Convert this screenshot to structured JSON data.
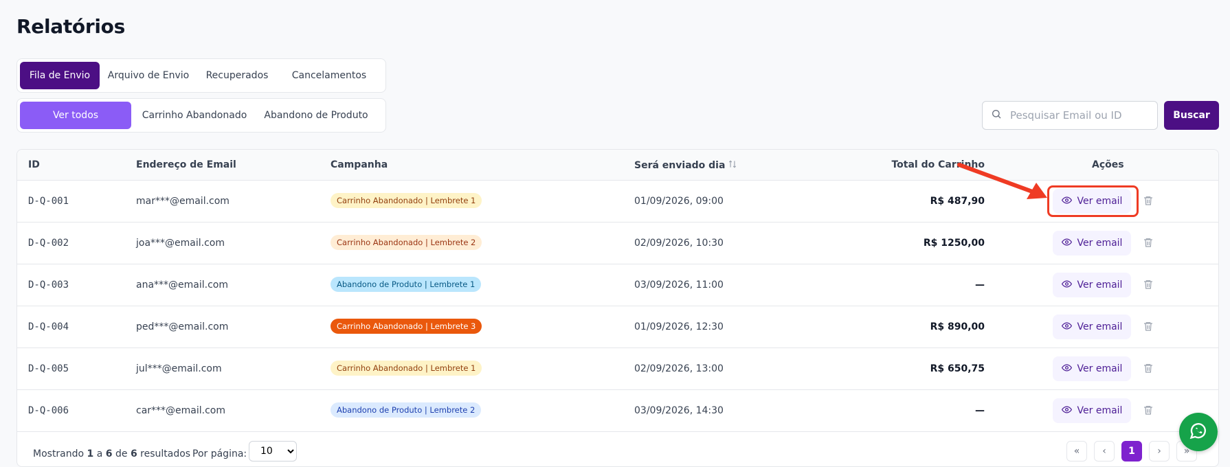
{
  "page": {
    "title": "Relatórios"
  },
  "tabs": [
    {
      "label": "Fila de Envio",
      "active": true
    },
    {
      "label": "Arquivo de Envio"
    },
    {
      "label": "Recuperados"
    },
    {
      "label": "Cancelamentos"
    }
  ],
  "subtabs": [
    {
      "label": "Ver todos",
      "active": true
    },
    {
      "label": "Carrinho Abandonado"
    },
    {
      "label": "Abandono de Produto"
    }
  ],
  "search": {
    "placeholder": "Pesquisar Email ou ID",
    "button_label": "Buscar"
  },
  "table": {
    "headers": {
      "id": "ID",
      "email": "Endereço de Email",
      "campaign": "Campanha",
      "date": "Será enviado dia",
      "total": "Total do Carrinho",
      "actions": "Ações"
    },
    "rows": [
      {
        "id": "D-Q-001",
        "email": "mar***@email.com",
        "campaign": "Carrinho Abandonado | Lembrete 1",
        "date": "01/09/2026, 09:00",
        "total": "R$ 487,90",
        "action": "Ver email"
      },
      {
        "id": "D-Q-002",
        "email": "joa***@email.com",
        "campaign": "Carrinho Abandonado | Lembrete 2",
        "date": "02/09/2026, 10:30",
        "total": "R$ 1250,00",
        "action": "Ver email"
      },
      {
        "id": "D-Q-003",
        "email": "ana***@email.com",
        "campaign": "Abandono de Produto | Lembrete 1",
        "date": "03/09/2026, 11:00",
        "total": "—",
        "action": "Ver email"
      },
      {
        "id": "D-Q-004",
        "email": "ped***@email.com",
        "campaign": "Carrinho Abandonado | Lembrete 3",
        "date": "01/09/2026, 12:30",
        "total": "R$ 890,00",
        "action": "Ver email"
      },
      {
        "id": "D-Q-005",
        "email": "jul***@email.com",
        "campaign": "Carrinho Abandonado | Lembrete 1",
        "date": "02/09/2026, 13:00",
        "total": "R$ 650,75",
        "action": "Ver email"
      },
      {
        "id": "D-Q-006",
        "email": "car***@email.com",
        "campaign": "Abandono de Produto | Lembrete 2",
        "date": "03/09/2026, 14:30",
        "total": "—",
        "action": "Ver email"
      }
    ]
  },
  "footer": {
    "showing_prefix": "Mostrando",
    "from": "1",
    "to_word": "a",
    "to": "6",
    "of_word": "de",
    "total": "6",
    "results_word": "resultados",
    "per_page_label": "Por página:",
    "per_page_value": "10",
    "current_page": "1"
  },
  "colors": {
    "primary_dark": "#4c0f84",
    "primary_light": "#8b5cf6",
    "annotation_red": "#ef3b24",
    "chat_green": "#16a34a"
  },
  "icons": [
    "search-icon",
    "sort-icon",
    "eye-icon",
    "trash-icon",
    "chevrons-left-icon",
    "chevron-left-icon",
    "chevron-right-icon",
    "chevrons-right-icon",
    "whatsapp-icon"
  ]
}
